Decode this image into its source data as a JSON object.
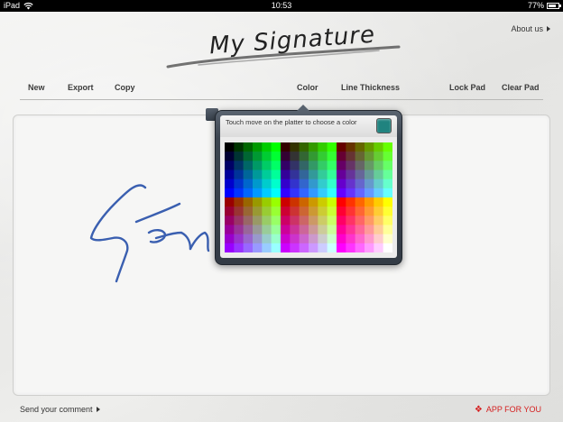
{
  "status_bar": {
    "device": "iPad",
    "time": "10:53",
    "battery": "77%",
    "battery_level": 0.77,
    "wifi_icon": "wifi-icon",
    "battery_icon": "battery-icon"
  },
  "app": {
    "title": "My Signature",
    "about_label": "About us"
  },
  "toolbar": {
    "new_label": "New",
    "export_label": "Export",
    "copy_label": "Copy",
    "color_label": "Color",
    "line_thickness_label": "Line Thickness",
    "lock_pad_label": "Lock Pad",
    "clear_pad_label": "Clear Pad"
  },
  "color_popover": {
    "hint": "Touch move on the platter to choose a color",
    "selected_color": "#20837f"
  },
  "signature": {
    "stroke_color": "#3a5fb0"
  },
  "footer": {
    "send_comment_label": "Send your comment",
    "app_for_you_label": "APP FOR YOU",
    "app_for_you_color": "#d52020"
  }
}
